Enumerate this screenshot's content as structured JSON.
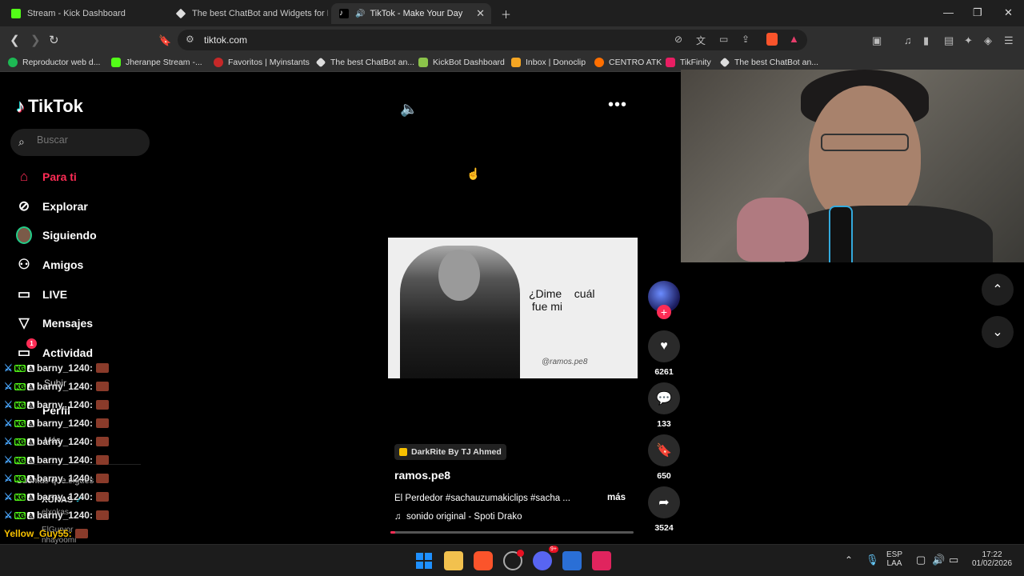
{
  "browser": {
    "tabs": [
      {
        "title": "Stream - Kick Dashboard",
        "favicon_color": "#53fc18"
      },
      {
        "title": "The best ChatBot and Widgets for Ki",
        "favicon_color": "#dddddd"
      },
      {
        "title": "TikTok - Make Your Day",
        "favicon_color": "#ffffff",
        "active": true
      }
    ],
    "url": "tiktok.com",
    "bookmarks": [
      {
        "label": "Reproductor web d...",
        "color": "#1db954"
      },
      {
        "label": "Jheranpe Stream -...",
        "color": "#53fc18"
      },
      {
        "label": "Favoritos | Myinstants",
        "color": "#c62828"
      },
      {
        "label": "The best ChatBot an...",
        "color": "#dddddd"
      },
      {
        "label": "KickBot Dashboard",
        "color": "#8bc34a"
      },
      {
        "label": "Inbox | Donoclip",
        "color": "#f5a623"
      },
      {
        "label": "CENTRO ATK",
        "color": "#ff6f00"
      },
      {
        "label": "TikFinity",
        "color": "#e91e63"
      },
      {
        "label": "The best ChatBot an...",
        "color": "#dddddd"
      }
    ]
  },
  "tiktok": {
    "logo": "TikTok",
    "search_placeholder": "Buscar",
    "nav": [
      {
        "label": "Para ti",
        "icon": "home-icon"
      },
      {
        "label": "Explorar",
        "icon": "compass-icon"
      },
      {
        "label": "Siguiendo",
        "icon": "following-avatar-icon"
      },
      {
        "label": "Amigos",
        "icon": "friends-icon"
      },
      {
        "label": "LIVE",
        "icon": "live-icon"
      },
      {
        "label": "Mensajes",
        "icon": "send-icon"
      },
      {
        "label": "Actividad",
        "icon": "activity-icon",
        "badge": "1"
      }
    ],
    "nav_hidden": {
      "subir": "Subir",
      "perfil": "Perfil",
      "mas": "Más",
      "following_title": "Cuentas que sigues",
      "following_user": "XOKAS",
      "acc2": "elxokas",
      "acc3": "ElGuryor",
      "acc4": "nhayoomi"
    },
    "video": {
      "overlay_text": "¿Dime    cuál\n fue mi",
      "watermark": "@ramos.pe8",
      "music_tag": "DarkRite By TJ Ahmed",
      "author": "ramos.pe8",
      "caption": "El Perdedor #sachauzumakiclips #sacha ...",
      "more": "más",
      "sound": "sonido original - Spoti Drako",
      "progress": 0.02,
      "likes": "6261",
      "comments": "133",
      "saves": "650",
      "shares": "3524"
    }
  },
  "chat_overlay": [
    {
      "user": "barny_1240:",
      "color": "#e8e8e8"
    },
    {
      "user": "barny_1240:",
      "color": "#e8e8e8"
    },
    {
      "user": "barny_1240:",
      "color": "#e8e8e8"
    },
    {
      "user": "barny_1240:",
      "color": "#e8e8e8"
    },
    {
      "user": "barny_1240:",
      "color": "#e8e8e8"
    },
    {
      "user": "barny_1240:",
      "color": "#e8e8e8"
    },
    {
      "user": "barny_1240:",
      "color": "#e8e8e8"
    },
    {
      "user": "barny_1240:",
      "color": "#e8e8e8"
    },
    {
      "user": "barny_1240:",
      "color": "#e8e8e8"
    },
    {
      "user": "Yellow_Guy55:",
      "color": "#f6c000"
    },
    {
      "user": "Yellow_Guy55:",
      "color": "#f6c000"
    },
    {
      "user": "Yellow_Guy55:",
      "color": "#f6c000"
    }
  ],
  "system": {
    "lang": "ESP",
    "layout": "LAA",
    "time": "17:22",
    "date": "01/02/2026",
    "discord_badge": "9+"
  }
}
